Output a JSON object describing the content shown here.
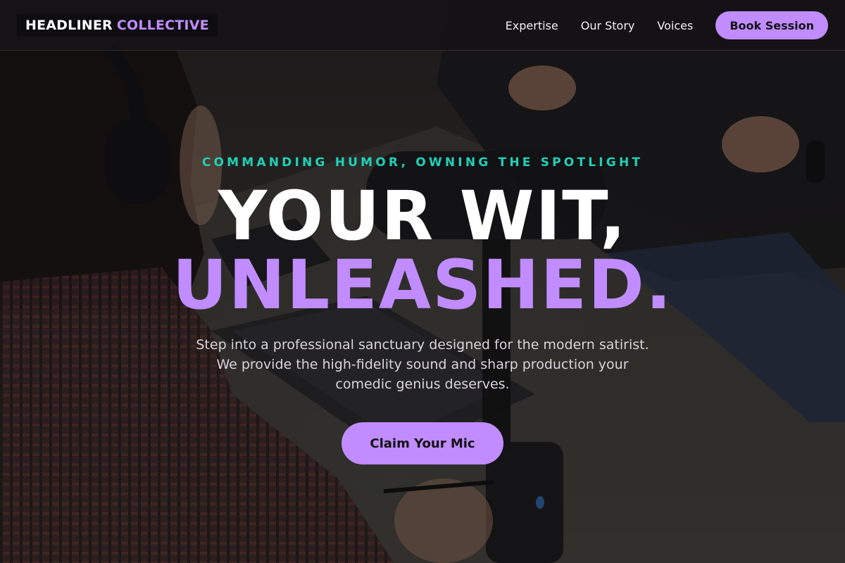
{
  "brand": {
    "part1": "HEADLINER",
    "part2": "COLLECTIVE",
    "accent_color": "#c08cff"
  },
  "nav": {
    "items": [
      {
        "label": "Expertise"
      },
      {
        "label": "Our Story"
      },
      {
        "label": "Voices"
      }
    ],
    "cta_label": "Book Session"
  },
  "hero": {
    "eyebrow": "COMMANDING HUMOR, OWNING THE SPOTLIGHT",
    "headline_line1": "YOUR WIT,",
    "headline_line2": "UNLEASHED.",
    "subtitle": "Step into a professional sanctuary designed for the modern satirist. We provide the high-fidelity sound and sharp production your comedic genius deserves.",
    "cta_label": "Claim Your Mic",
    "eyebrow_color": "#1fd1b8",
    "background_image": "podcast-studio-photo"
  }
}
